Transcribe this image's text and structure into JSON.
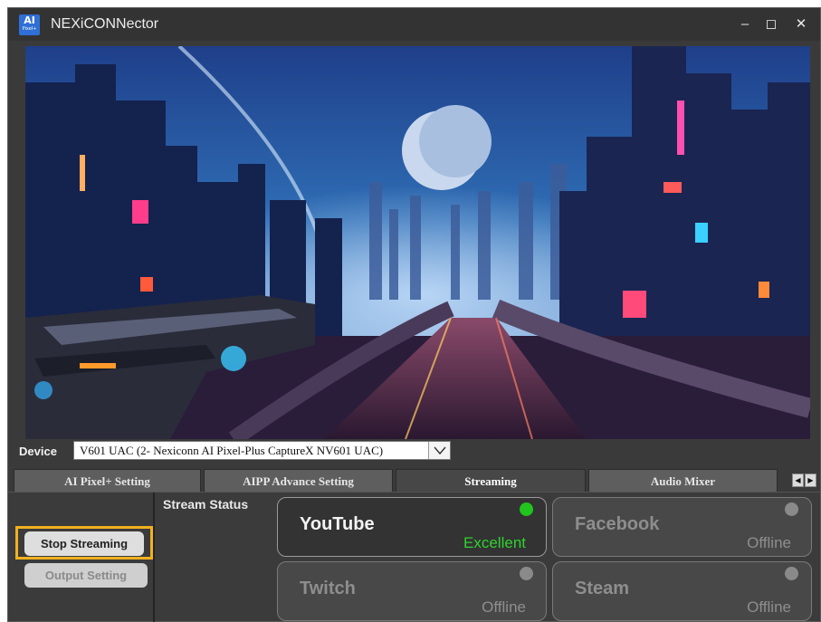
{
  "window": {
    "title": "NEXiCONNector",
    "logo_line1": "AI",
    "logo_line2": "Pixel+",
    "minimize_glyph": "–",
    "maximize_glyph": "◻",
    "close_glyph": "✕"
  },
  "device": {
    "label": "Device",
    "value": "V601 UAC (2- Nexiconn AI Pixel-Plus CaptureX NV601 UAC)"
  },
  "tabs": [
    {
      "label": "AI Pixel+ Setting",
      "active": false
    },
    {
      "label": "AIPP Advance Setting",
      "active": false
    },
    {
      "label": "Streaming",
      "active": true
    },
    {
      "label": "Audio Mixer",
      "active": false
    }
  ],
  "tab_scroll": {
    "left_glyph": "◀",
    "right_glyph": "▶"
  },
  "controls": {
    "stop_streaming_label": "Stop Streaming",
    "output_setting_label": "Output Setting",
    "stream_status_label": "Stream Status"
  },
  "platforms": [
    {
      "name": "YouTube",
      "status": "Excellent",
      "active": true
    },
    {
      "name": "Facebook",
      "status": "Offline",
      "active": false
    },
    {
      "name": "Twitch",
      "status": "Offline",
      "active": false
    },
    {
      "name": "Steam",
      "status": "Offline",
      "active": false
    }
  ],
  "colors": {
    "highlight_frame": "#f2b01e",
    "status_excellent": "#2fd22f",
    "status_dot_live": "#22c41e",
    "status_dot_idle": "#8a8a8a"
  }
}
